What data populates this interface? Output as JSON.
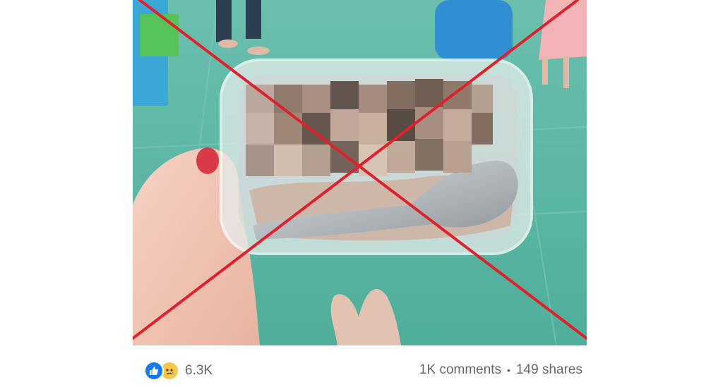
{
  "post": {
    "image": {
      "description_icon": "blurred-food-photo",
      "overlay": "red-x-mark",
      "overlay_color": "#e0202a"
    },
    "reactions": {
      "icons": [
        "like-icon",
        "sad-icon"
      ],
      "count": "6.3K",
      "like_color": "#1877f2",
      "sad_color": "#f7c64a"
    },
    "stats": {
      "comments": "1K comments",
      "separator": "•",
      "shares": "149 shares"
    }
  }
}
